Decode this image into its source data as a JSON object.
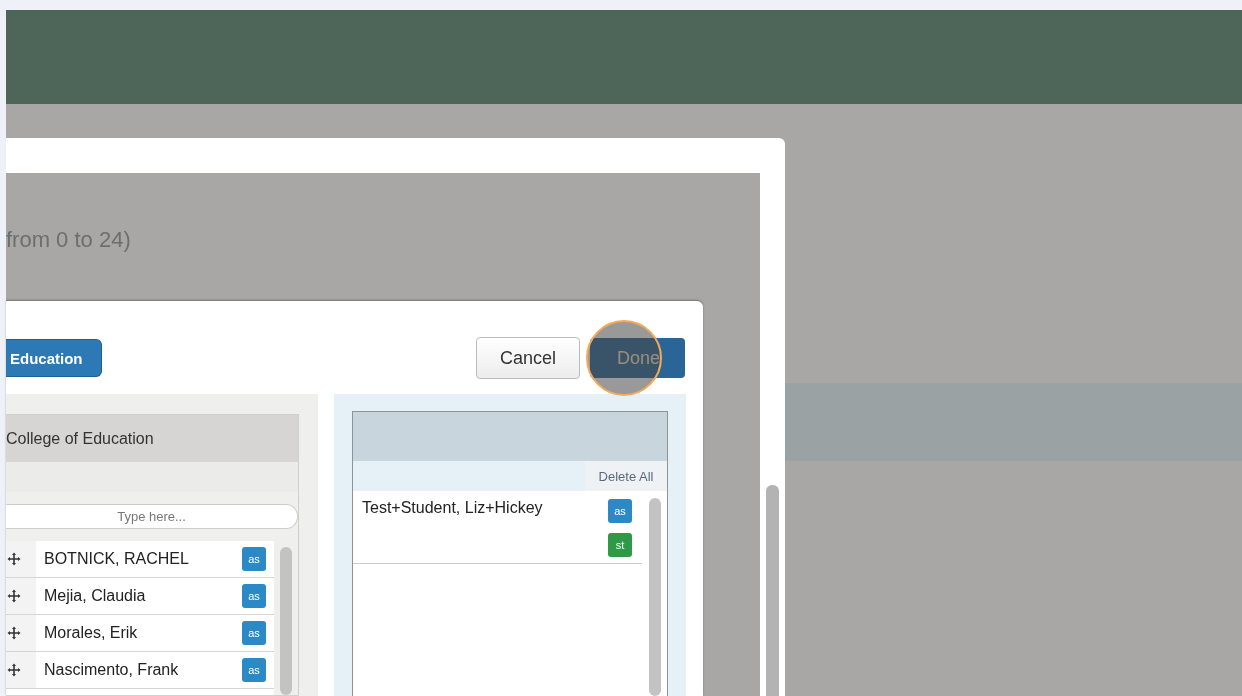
{
  "background_page": {
    "hint_text": "from 0 to 24)"
  },
  "dialog": {
    "college_button": "Education",
    "cancel_button": "Cancel",
    "done_button": "Done",
    "available": {
      "title": "College of Education",
      "search": {
        "placeholder": "Type here..."
      },
      "rows": [
        {
          "name": "BOTNICK, RACHEL",
          "badges": [
            {
              "label": "as",
              "color": "#2b8ac6"
            }
          ]
        },
        {
          "name": "Mejia, Claudia",
          "badges": [
            {
              "label": "as",
              "color": "#2b8ac6"
            }
          ]
        },
        {
          "name": "Morales, Erik",
          "badges": [
            {
              "label": "as",
              "color": "#2b8ac6"
            }
          ]
        },
        {
          "name": "Nascimento, Frank",
          "badges": [
            {
              "label": "as",
              "color": "#2b8ac6"
            }
          ]
        }
      ]
    },
    "selected": {
      "delete_all": "Delete All",
      "rows": [
        {
          "name": "Test+Student, Liz+Hickey",
          "badges": [
            {
              "label": "as",
              "color": "#2b8ac6"
            },
            {
              "label": "st",
              "color": "#2e9a46"
            }
          ]
        }
      ]
    }
  }
}
